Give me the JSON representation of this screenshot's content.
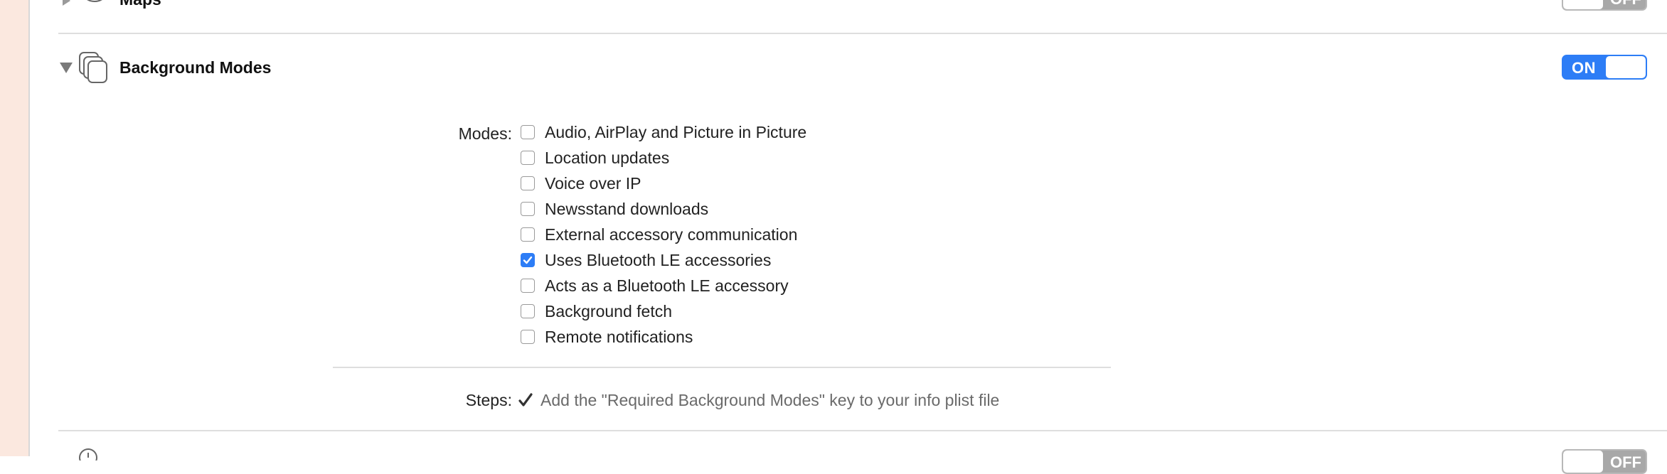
{
  "maps_section": {
    "title": "Maps",
    "toggle_label": "OFF"
  },
  "background_modes": {
    "title": "Background Modes",
    "toggle_label": "ON",
    "modes_label": "Modes:",
    "modes": [
      {
        "label": "Audio, AirPlay and Picture in Picture",
        "checked": false
      },
      {
        "label": "Location updates",
        "checked": false
      },
      {
        "label": "Voice over IP",
        "checked": false
      },
      {
        "label": "Newsstand downloads",
        "checked": false
      },
      {
        "label": "External accessory communication",
        "checked": false
      },
      {
        "label": "Uses Bluetooth LE accessories",
        "checked": true
      },
      {
        "label": "Acts as a Bluetooth LE accessory",
        "checked": false
      },
      {
        "label": "Background fetch",
        "checked": false
      },
      {
        "label": "Remote notifications",
        "checked": false
      }
    ],
    "steps_label": "Steps:",
    "steps": [
      {
        "text": "Add the \"Required Background Modes\" key to your info plist file",
        "done": true
      }
    ]
  },
  "next_section": {
    "toggle_label": "OFF"
  },
  "colors": {
    "accent": "#2d7df6",
    "sidebar": "#fbe8df",
    "divider": "#dedede"
  }
}
